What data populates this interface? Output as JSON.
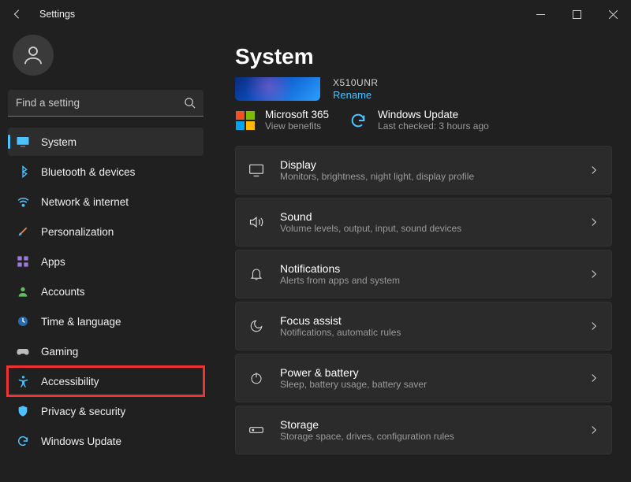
{
  "titlebar": {
    "title": "Settings"
  },
  "search": {
    "placeholder": "Find a setting"
  },
  "device": {
    "name": "X510UNR",
    "rename": "Rename"
  },
  "info": {
    "ms365": {
      "title": "Microsoft 365",
      "sub": "View benefits"
    },
    "wu": {
      "title": "Windows Update",
      "sub": "Last checked: 3 hours ago"
    }
  },
  "page": {
    "title": "System"
  },
  "nav": [
    {
      "label": "System"
    },
    {
      "label": "Bluetooth & devices"
    },
    {
      "label": "Network & internet"
    },
    {
      "label": "Personalization"
    },
    {
      "label": "Apps"
    },
    {
      "label": "Accounts"
    },
    {
      "label": "Time & language"
    },
    {
      "label": "Gaming"
    },
    {
      "label": "Accessibility"
    },
    {
      "label": "Privacy & security"
    },
    {
      "label": "Windows Update"
    }
  ],
  "cards": [
    {
      "title": "Display",
      "sub": "Monitors, brightness, night light, display profile"
    },
    {
      "title": "Sound",
      "sub": "Volume levels, output, input, sound devices"
    },
    {
      "title": "Notifications",
      "sub": "Alerts from apps and system"
    },
    {
      "title": "Focus assist",
      "sub": "Notifications, automatic rules"
    },
    {
      "title": "Power & battery",
      "sub": "Sleep, battery usage, battery saver"
    },
    {
      "title": "Storage",
      "sub": "Storage space, drives, configuration rules"
    }
  ]
}
